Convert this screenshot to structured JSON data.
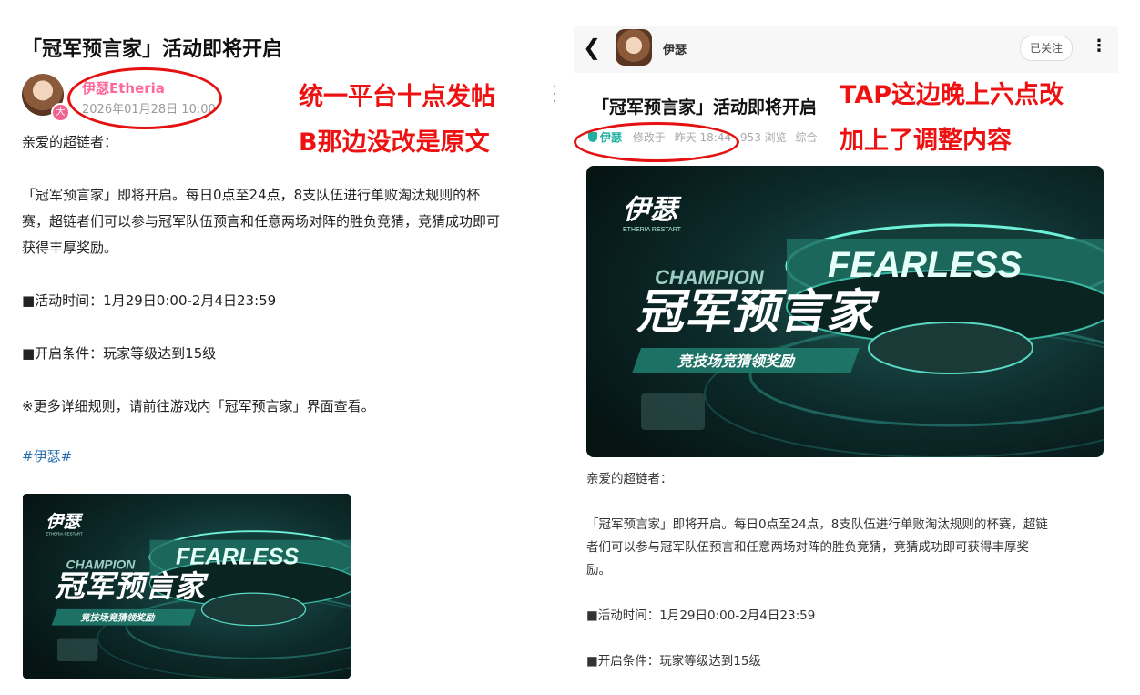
{
  "left": {
    "title": "「冠军预言家」活动即将开启",
    "author_name": "伊瑟Etheria",
    "author_badge": "大",
    "post_date": "2026年01月28日 10:00",
    "body": [
      "亲爱的超链者：",
      "「冠军预言家」即将开启。每日0点至24点，8支队伍进行单败淘汰规则的杯",
      "赛，超链者们可以参与冠军队伍预言和任意两场对阵的胜负竞猜，竞猜成功即可",
      "获得丰厚奖励。",
      "■活动时间：1月29日0:00-2月4日23:59",
      "■开启条件：玩家等级达到15级",
      "※更多详细规则，请前往游戏内「冠军预言家」界面查看。"
    ],
    "hashtag": "#伊瑟#"
  },
  "right": {
    "author_name": "伊瑟",
    "follow_label": "已关注",
    "title": "「冠军预言家」活动即将开启",
    "meta_user": "伊瑟",
    "meta_edited": "修改于",
    "meta_time": "昨天 18:44",
    "meta_views": "953 浏览",
    "meta_tag": "综合",
    "body": [
      "亲爱的超链者：",
      "「冠军预言家」即将开启。每日0点至24点，8支队伍进行单败淘汰规则的杯赛，超链",
      "者们可以参与冠军队伍预言和任意两场对阵的胜负竞猜，竞猜成功即可获得丰厚奖",
      "励。",
      "■活动时间：1月29日0:00-2月4日23:59",
      "■开启条件：玩家等级达到15级"
    ]
  },
  "banner": {
    "logo": "伊瑟",
    "logo_sub": "ETHERIA RESTART",
    "fearless": "FEARLESS",
    "champion": "CHAMPION",
    "main": "冠军预言家",
    "sub": "竞技场竞猜领奖励"
  },
  "annotations": {
    "a1": "统一平台十点发帖",
    "a2": "B那边没改是原文",
    "a3": "TAP这边晚上六点改",
    "a4": "加上了调整内容"
  },
  "colors": {
    "annotation": "#ee1111",
    "left_name": "#ff6699",
    "hashtag": "#2a6fb0",
    "tap_user": "#20b0a0"
  }
}
